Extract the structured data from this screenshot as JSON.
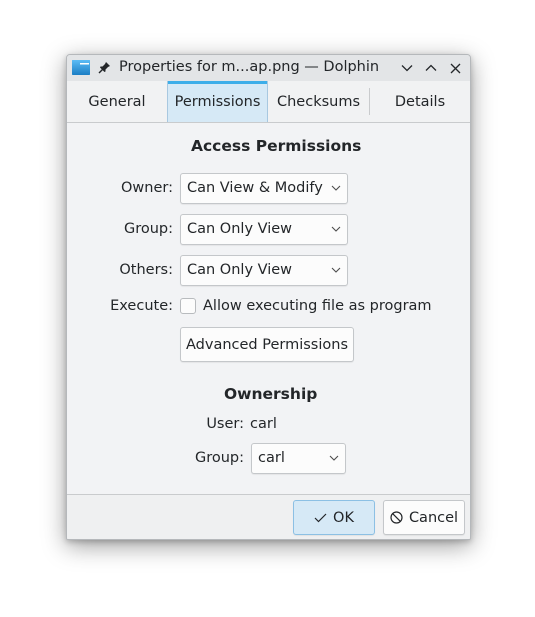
{
  "window": {
    "title": "Properties for m...ap.png — Dolphin",
    "app_icon": "folder-icon",
    "pin_icon": "pin-icon",
    "controls": [
      "minimize",
      "maximize",
      "close"
    ]
  },
  "tabs": [
    {
      "label": "General",
      "active": false
    },
    {
      "label": "Permissions",
      "active": true
    },
    {
      "label": "Checksums",
      "active": false
    },
    {
      "label": "Details",
      "active": false
    }
  ],
  "access": {
    "heading": "Access Permissions",
    "owner_label": "Owner:",
    "owner_value": "Can View & Modify",
    "group_label": "Group:",
    "group_value": "Can Only View",
    "others_label": "Others:",
    "others_value": "Can Only View",
    "execute_label": "Execute:",
    "execute_checkbox_label": "Allow executing file as program",
    "execute_checked": false,
    "advanced_button": "Advanced Permissions"
  },
  "ownership": {
    "heading": "Ownership",
    "user_label": "User:",
    "user_value": "carl",
    "group_label": "Group:",
    "group_value": "carl"
  },
  "footer": {
    "ok_label": "OK",
    "cancel_label": "Cancel"
  }
}
